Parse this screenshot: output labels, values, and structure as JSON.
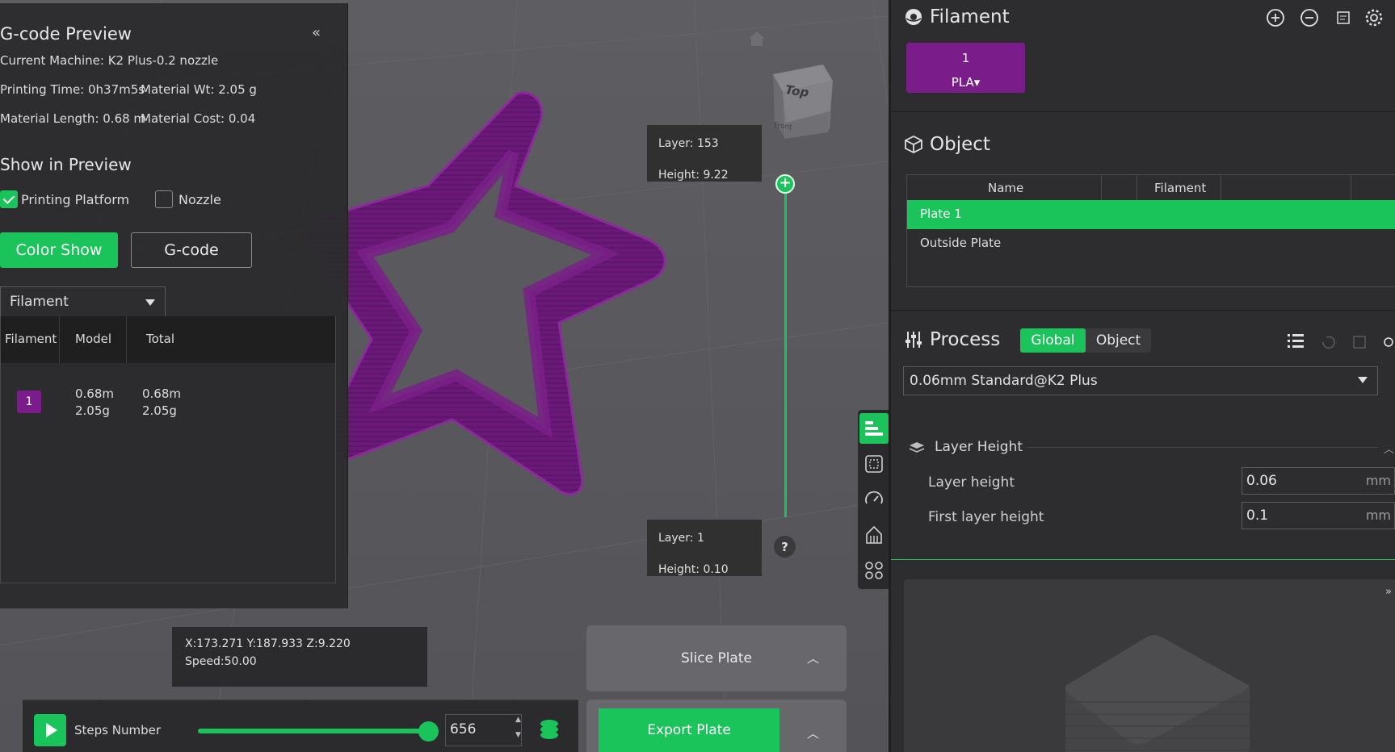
{
  "gcode_preview": {
    "title": "G-code Preview",
    "collapse_label": "«",
    "current_machine": "Current Machine: K2 Plus-0.2 nozzle",
    "printing_time": "Printing Time: 0h37m5s",
    "material_wt": "Material Wt: 2.05 g",
    "material_length": "Material Length: 0.68 m",
    "material_cost": "Material Cost: 0.04",
    "show_in_preview": "Show in Preview",
    "printing_platform": {
      "label": "Printing Platform",
      "checked": true
    },
    "nozzle": {
      "label": "Nozzle",
      "checked": false
    },
    "color_show_label": "Color Show",
    "gcode_label": "G-code",
    "view_type": "Filament",
    "table": {
      "headers": [
        "Filament",
        "Model",
        "Total"
      ],
      "rows": [
        {
          "filament": "1",
          "model_len": "0.68m",
          "model_wt": "2.05g",
          "total_len": "0.68m",
          "total_wt": "2.05g"
        }
      ]
    }
  },
  "layer_slider": {
    "top_layer": "Layer: 153",
    "top_height": "Height: 9.22",
    "bottom_layer": "Layer: 1",
    "bottom_height": "Height: 0.10",
    "knob_symbol": "+",
    "help_symbol": "?"
  },
  "view_cube": {
    "top": "Top",
    "front": "Front"
  },
  "coords": {
    "position": "X:173.271  Y:187.933  Z:9.220",
    "speed": "Speed:50.00"
  },
  "slice_plate_label": "Slice Plate",
  "export_plate_label": "Export Plate",
  "steps": {
    "label": "Steps Number",
    "value": "656",
    "progress": 1.0
  },
  "filament_section": {
    "title": "Filament",
    "card_number": "1",
    "card_type": "PLA▾",
    "card_color": "#7a1d8a"
  },
  "object_section": {
    "title": "Object",
    "headers": [
      "Name",
      "Filament"
    ],
    "rows": [
      "Plate 1",
      "Outside Plate"
    ]
  },
  "process_section": {
    "title": "Process",
    "tabs": [
      "Global",
      "Object"
    ],
    "preset": "0.06mm Standard@K2 Plus",
    "group_title": "Layer Height",
    "params": [
      {
        "label": "Layer height",
        "value": "0.06",
        "unit": "mm"
      },
      {
        "label": "First layer height",
        "value": "0.1",
        "unit": "mm"
      }
    ]
  },
  "colors": {
    "accent": "#1bc45a",
    "filament": "#7a1d8a",
    "panel": "#2d2d2f",
    "viewport": "#5b5b5f"
  }
}
